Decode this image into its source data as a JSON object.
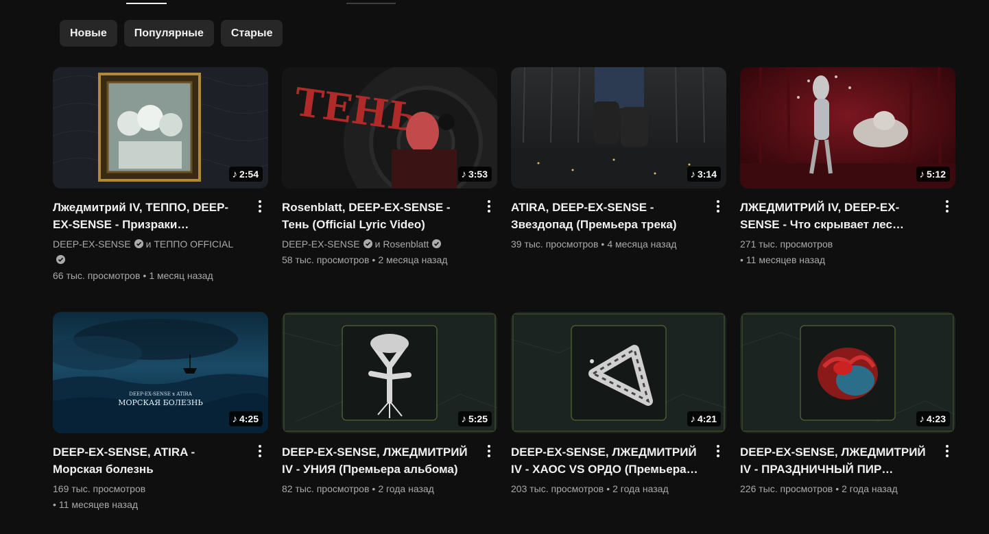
{
  "filters": [
    {
      "label": "Новые"
    },
    {
      "label": "Популярные"
    },
    {
      "label": "Старые"
    }
  ],
  "separator": "•",
  "videos": [
    {
      "title": "Лжедмитрий IV, ТЕППО, DEEP-EX-SENSE - Призраки настоящего (Премьера трека)",
      "duration": "2:54",
      "channels": [
        "DEEP-EX-SENSE",
        "ТЕППО OFFICIAL"
      ],
      "joiner": "и",
      "views": "66 тыс. просмотров",
      "age": "1 месяц назад",
      "thumb": "frame"
    },
    {
      "title": "Rosenblatt, DEEP-EX-SENSE - Тень (Official Lyric Video)",
      "duration": "3:53",
      "channels": [
        "DEEP-EX-SENSE",
        "Rosenblatt"
      ],
      "joiner": "и",
      "views": "58 тыс. просмотров",
      "age": "2 месяца назад",
      "thumb": "shadow",
      "thumb_text": "ТЕНЬ"
    },
    {
      "title": "ATIRA, DEEP-EX-SENSE - Звездопад (Премьера трека)",
      "duration": "3:14",
      "views": "39 тыс. просмотров",
      "age": "4 месяца назад",
      "thumb": "legs"
    },
    {
      "title": "ЛЖЕДМИТРИЙ IV, DEEP-EX-SENSE - Что скрывает лес (Премьера трека)",
      "duration": "5:12",
      "views": "271 тыс. просмотров",
      "age": "11 месяцев назад",
      "thumb": "forest"
    },
    {
      "title": "DEEP-EX-SENSE, ATIRA - Морская болезнь",
      "duration": "4:25",
      "views": "169 тыс. просмотров",
      "age": "11 месяцев назад",
      "thumb": "sea",
      "thumb_text": "DEEP-EX-SENSE x ATIRA",
      "thumb_text2": "МОРСКАЯ БОЛЕЗНЬ"
    },
    {
      "title": "DEEP-EX-SENSE, ЛЖЕДМИТРИЙ IV - УНИЯ (Премьера альбома)",
      "duration": "5:25",
      "views": "82 тыс. просмотров",
      "age": "2 года назад",
      "thumb": "tree"
    },
    {
      "title": "DEEP-EX-SENSE, ЛЖЕДМИТРИЙ IV - ХАОС VS ОРДО (Премьера трека)",
      "duration": "4:21",
      "views": "203 тыс. просмотров",
      "age": "2 года назад",
      "thumb": "cube"
    },
    {
      "title": "DEEP-EX-SENSE, ЛЖЕДМИТРИЙ IV - ПРАЗДНИЧНЫЙ ПИР (Премьера трека)",
      "duration": "4:23",
      "views": "226 тыс. просмотров",
      "age": "2 года назад",
      "thumb": "heart"
    }
  ],
  "icons": {
    "duration": "music-note-icon",
    "verified": "verified-icon",
    "menu": "more-vert-icon"
  },
  "colors": {
    "background": "#0f0f0f",
    "chip": "#272727",
    "text": "#f1f1f1",
    "secondary": "#aaaaaa"
  }
}
